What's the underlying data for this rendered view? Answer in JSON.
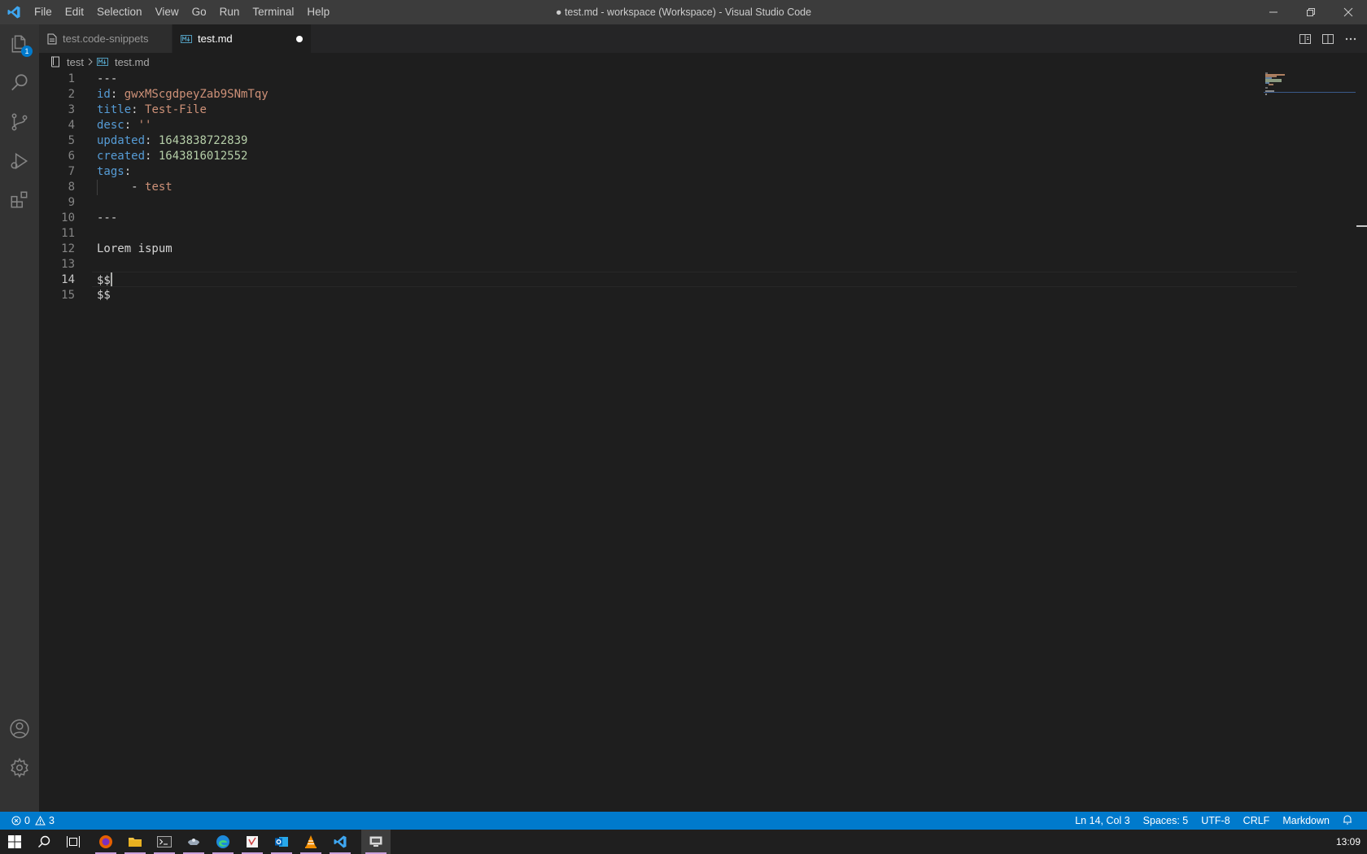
{
  "window": {
    "title": "● test.md - workspace (Workspace) - Visual Studio Code",
    "menu": [
      "File",
      "Edit",
      "Selection",
      "View",
      "Go",
      "Run",
      "Terminal",
      "Help"
    ]
  },
  "activity_bar": {
    "explorer_badge": "1",
    "items": [
      "explorer-icon",
      "search-icon",
      "source-control-icon",
      "run-debug-icon",
      "extensions-icon"
    ],
    "bottom": [
      "account-icon",
      "manage-gear-icon"
    ]
  },
  "tabs": [
    {
      "label": "test.code-snippets",
      "active": false,
      "dirty": false
    },
    {
      "label": "test.md",
      "active": true,
      "dirty": true
    }
  ],
  "breadcrumb": {
    "folder": "test",
    "file": "test.md"
  },
  "editor": {
    "current_line": 14,
    "lines": [
      {
        "n": "1",
        "segments": [
          {
            "t": "---",
            "c": "plain"
          }
        ]
      },
      {
        "n": "2",
        "segments": [
          {
            "t": "id",
            "c": "key"
          },
          {
            "t": ": ",
            "c": "plain"
          },
          {
            "t": "gwxMScgdpeyZab9SNmTqy",
            "c": "str"
          }
        ]
      },
      {
        "n": "3",
        "segments": [
          {
            "t": "title",
            "c": "key"
          },
          {
            "t": ": ",
            "c": "plain"
          },
          {
            "t": "Test-File",
            "c": "str"
          }
        ]
      },
      {
        "n": "4",
        "segments": [
          {
            "t": "desc",
            "c": "key"
          },
          {
            "t": ": ",
            "c": "plain"
          },
          {
            "t": "''",
            "c": "str"
          }
        ]
      },
      {
        "n": "5",
        "segments": [
          {
            "t": "updated",
            "c": "key"
          },
          {
            "t": ": ",
            "c": "plain"
          },
          {
            "t": "1643838722839",
            "c": "num"
          }
        ]
      },
      {
        "n": "6",
        "segments": [
          {
            "t": "created",
            "c": "key"
          },
          {
            "t": ": ",
            "c": "plain"
          },
          {
            "t": "1643816012552",
            "c": "num"
          }
        ]
      },
      {
        "n": "7",
        "segments": [
          {
            "t": "tags",
            "c": "key"
          },
          {
            "t": ":",
            "c": "plain"
          }
        ]
      },
      {
        "n": "8",
        "segments": [
          {
            "t": "     - ",
            "c": "plain"
          },
          {
            "t": "test",
            "c": "str"
          }
        ]
      },
      {
        "n": "9",
        "segments": []
      },
      {
        "n": "10",
        "segments": [
          {
            "t": "---",
            "c": "plain"
          }
        ]
      },
      {
        "n": "11",
        "segments": []
      },
      {
        "n": "12",
        "segments": [
          {
            "t": "Lorem ispum",
            "c": "plain"
          }
        ]
      },
      {
        "n": "13",
        "segments": []
      },
      {
        "n": "14",
        "segments": [
          {
            "t": "$$",
            "c": "plain"
          }
        ]
      },
      {
        "n": "15",
        "segments": [
          {
            "t": "$$",
            "c": "plain"
          }
        ]
      }
    ]
  },
  "status_bar": {
    "errors": "0",
    "warnings": "3",
    "position": "Ln 14, Col 3",
    "spaces": "Spaces: 5",
    "encoding": "UTF-8",
    "eol": "CRLF",
    "language": "Markdown"
  },
  "taskbar": {
    "clock": "13:09",
    "apps": [
      "windows-start-icon",
      "search-icon",
      "task-view-icon",
      "firefox-icon",
      "file-explorer-icon",
      "terminal-icon",
      "app-icon",
      "edge-icon",
      "notes-icon",
      "outlook-icon",
      "vlc-icon",
      "vscode-icon",
      "active-window-icon"
    ]
  },
  "colors": {
    "accent": "#007acc",
    "yaml_key": "#569cd6",
    "yaml_string": "#ce9178",
    "yaml_number": "#b5cea8"
  }
}
